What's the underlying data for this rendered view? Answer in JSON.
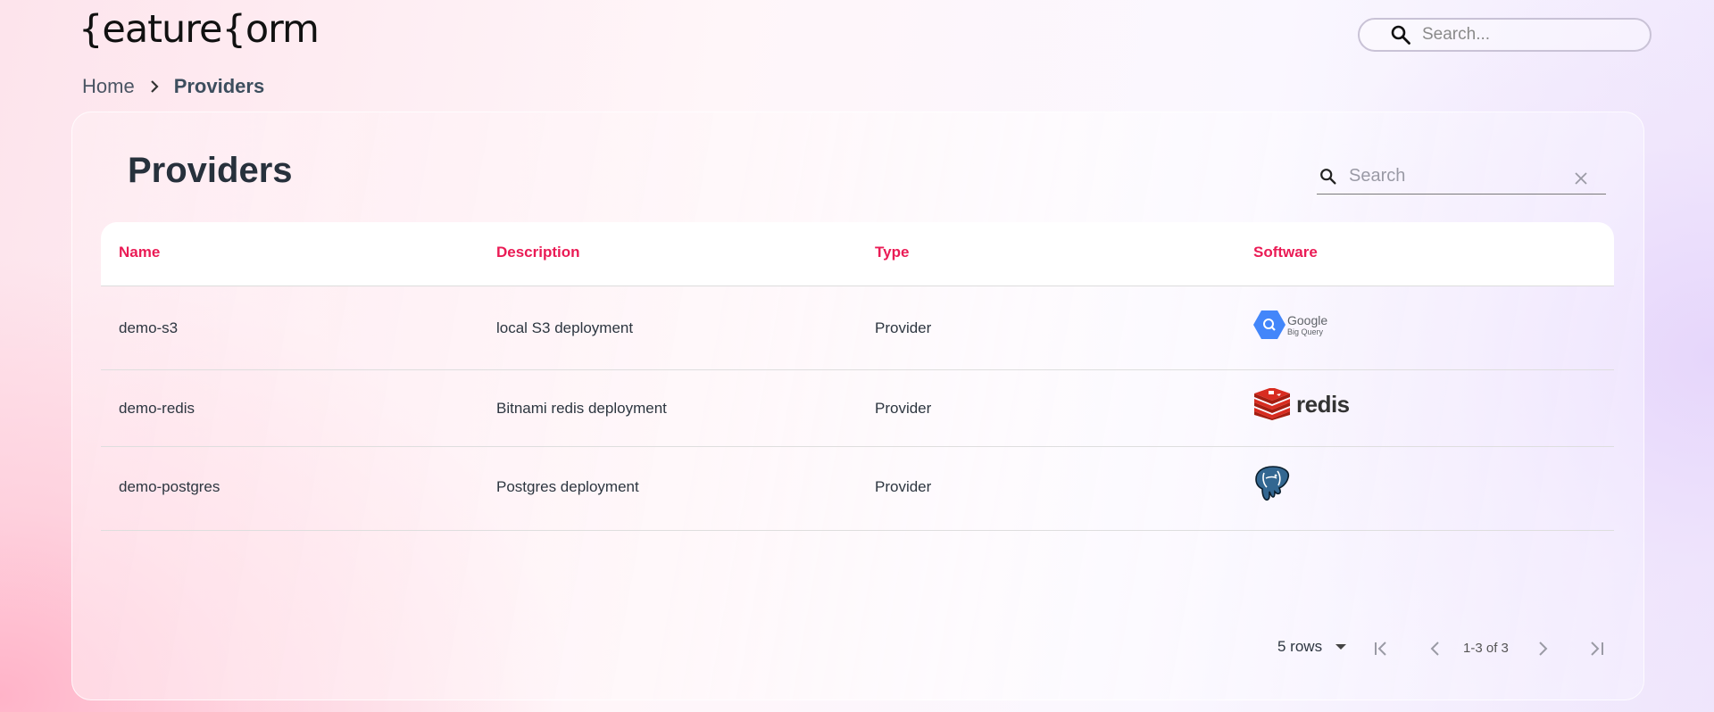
{
  "header": {
    "logo_text": "{eature{orm",
    "search_placeholder": "Search..."
  },
  "breadcrumb": {
    "home": "Home",
    "current": "Providers"
  },
  "page": {
    "title": "Providers",
    "search_placeholder": "Search"
  },
  "table": {
    "columns": [
      "Name",
      "Description",
      "Type",
      "Software"
    ],
    "rows": [
      {
        "name": "demo-s3",
        "description": "local S3 deployment",
        "type": "Provider",
        "software": "bigquery-logo"
      },
      {
        "name": "demo-redis",
        "description": "Bitnami redis deployment",
        "type": "Provider",
        "software": "redis-logo"
      },
      {
        "name": "demo-postgres",
        "description": "Postgres deployment",
        "type": "Provider",
        "software": "postgres-logo"
      }
    ],
    "bigquery_text_1": "Google",
    "bigquery_text_2": "Big Query",
    "redis_text": "redis"
  },
  "pagination": {
    "rows_label": "5 rows",
    "range_label": "1-3 of 3"
  },
  "colors": {
    "accent": "#ea1b55",
    "title": "#27313c"
  }
}
